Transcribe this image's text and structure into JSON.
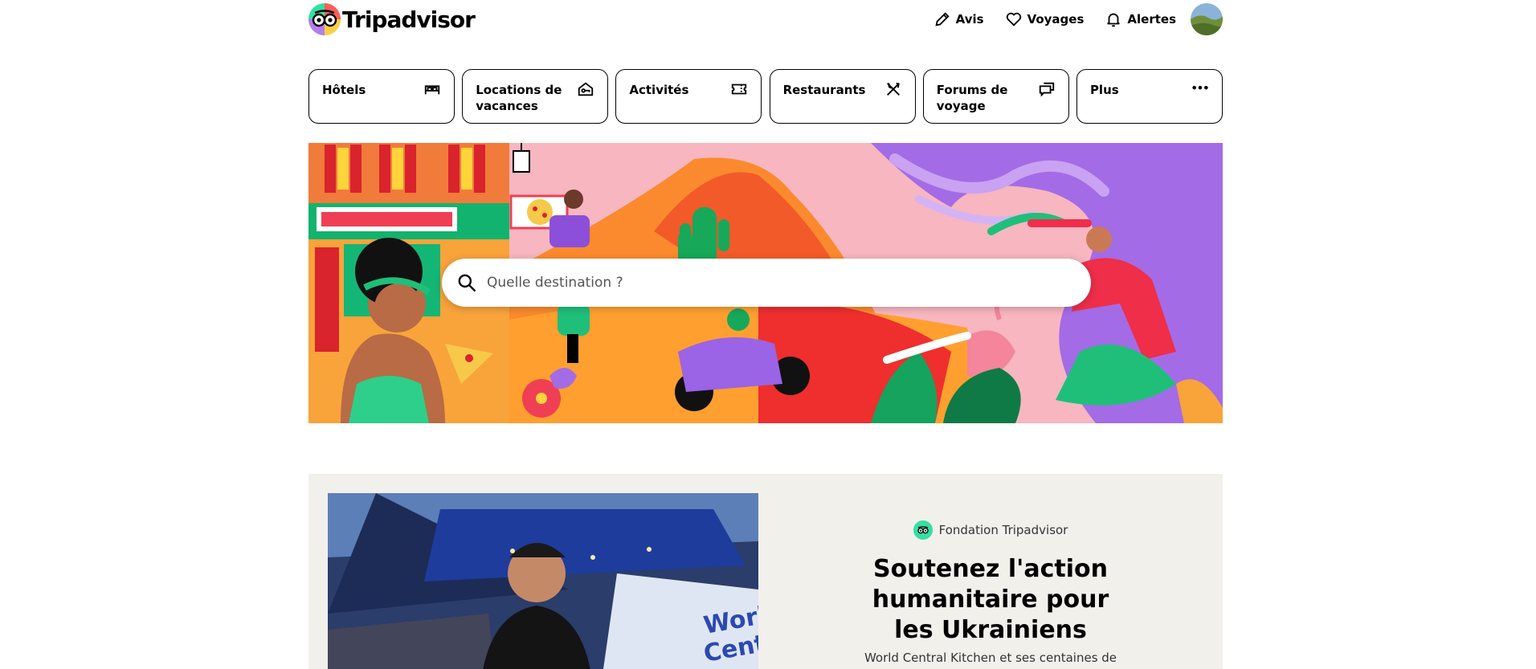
{
  "header": {
    "brand": "Tripadvisor",
    "nav": [
      {
        "label": "Avis",
        "icon": "pencil-icon"
      },
      {
        "label": "Voyages",
        "icon": "heart-icon"
      },
      {
        "label": "Alertes",
        "icon": "bell-icon"
      }
    ]
  },
  "categories": [
    {
      "label": "Hôtels",
      "icon": "bed-icon"
    },
    {
      "label": "Locations de vacances",
      "icon": "house-key-icon"
    },
    {
      "label": "Activités",
      "icon": "ticket-icon"
    },
    {
      "label": "Restaurants",
      "icon": "fork-knife-icon"
    },
    {
      "label": "Forums de voyage",
      "icon": "chat-bubbles-icon"
    },
    {
      "label": "Plus",
      "icon": "more-dots-icon"
    }
  ],
  "search": {
    "placeholder": "Quelle destination ?"
  },
  "promo": {
    "foundation_label": "Fondation Tripadvisor",
    "title": "Soutenez l'action humanitaire pour les Ukrainiens",
    "body": "World Central Kitchen et ses centaines de"
  },
  "colors": {
    "brand_green": "#34e0a1",
    "promo_bg": "#f2f0eb",
    "hero_pink": "#f7b6c0",
    "hero_purple": "#a46be6",
    "hero_orange": "#f9a33b"
  }
}
